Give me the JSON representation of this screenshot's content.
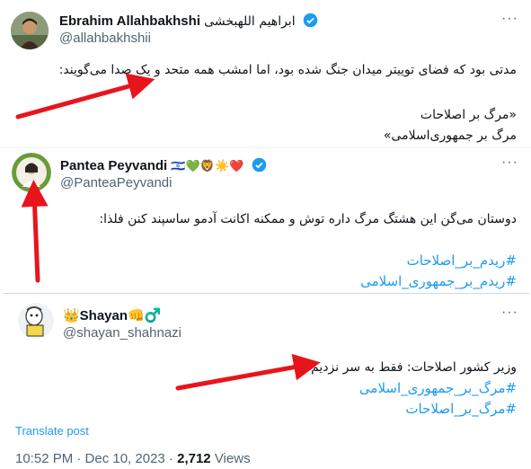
{
  "tweet1": {
    "name": "Ebrahim Allahbakhshi",
    "name_fa": "ابراهیم اللهبخشی",
    "handle": "@allahbakhshii",
    "line1": "مدتی بود که فضای توییتر میدان جنگ شده بود، اما امشب همه متحد و یک صدا می‌گویند:",
    "line2": "«مرگ بر اصلاحات",
    "line3": "مرگ بر جمهوری‌اسلامی»"
  },
  "tweet2": {
    "name": "Pantea Peyvandi",
    "emojis": "🇮🇱💚🦁☀️❤️",
    "handle": "@PanteaPeyvandi",
    "text": "دوستان می‌گن این هشتگ مرگ داره توش و ممکنه اکانت آدمو ساسپند کنن فلذا:",
    "tag1": "#ریدم_بر_اصلاحات",
    "tag2": "#ریدم_بر_جمهوری_اسلامی"
  },
  "tweet3": {
    "name": "👑Shayan👊♂️",
    "handle": "@shayan_shahnazi",
    "text": "وزیر کشور اصلاحات: فقط به سر نزدیم!",
    "tag1": "#مرگ_بر_جمهوری_اسلامی",
    "tag2": "#مرگ_بر_اصلاحات",
    "translate": "Translate post"
  },
  "footer": {
    "time": "10:52 PM · Dec 10, 2023 · ",
    "views_count": "2,712",
    "views_label": " Views"
  },
  "colors": {
    "accent": "#1d9bf0",
    "arrow": "#e8141c",
    "muted": "#536471"
  }
}
